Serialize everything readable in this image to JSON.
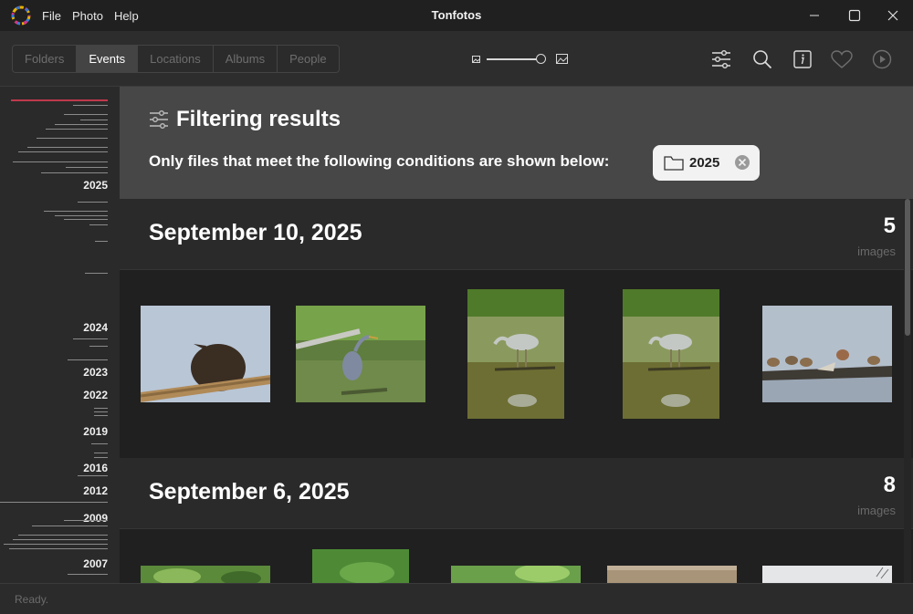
{
  "app": {
    "title": "Tonfotos",
    "menu": [
      "File",
      "Photo",
      "Help"
    ]
  },
  "toolbar": {
    "tabs": [
      {
        "label": "Folders",
        "active": false
      },
      {
        "label": "Events",
        "active": true
      },
      {
        "label": "Locations",
        "active": false
      },
      {
        "label": "Albums",
        "active": false
      },
      {
        "label": "People",
        "active": false
      }
    ],
    "zoom_level": 0.9,
    "icons": [
      "filter-sliders-icon",
      "search-icon",
      "info-icon",
      "heart-icon",
      "play-icon"
    ]
  },
  "timeline": {
    "years": [
      "2025",
      "2024",
      "2023",
      "2022",
      "2019",
      "2016",
      "2012",
      "2009",
      "2007"
    ]
  },
  "filter": {
    "title": "Filtering results",
    "description": "Only files that meet the following conditions are shown below:",
    "chip_label": "2025"
  },
  "events": [
    {
      "date": "September 10, 2025",
      "count": "5",
      "unit": "images",
      "photos": [
        "bird-on-branch",
        "heron-in-reeds",
        "heron-reflection",
        "heron-reflection-2",
        "sandpipers-on-log"
      ]
    },
    {
      "date": "September 6, 2025",
      "count": "8",
      "unit": "images",
      "photos": [
        "green-leaves",
        "green-foliage",
        "green-plants",
        "brown-ground",
        "white-sky"
      ]
    }
  ],
  "status": {
    "text": "Ready."
  },
  "colors": {
    "accent_timeline": "#c0394b",
    "filter_panel": "#474747",
    "active_tab": "#444444"
  }
}
